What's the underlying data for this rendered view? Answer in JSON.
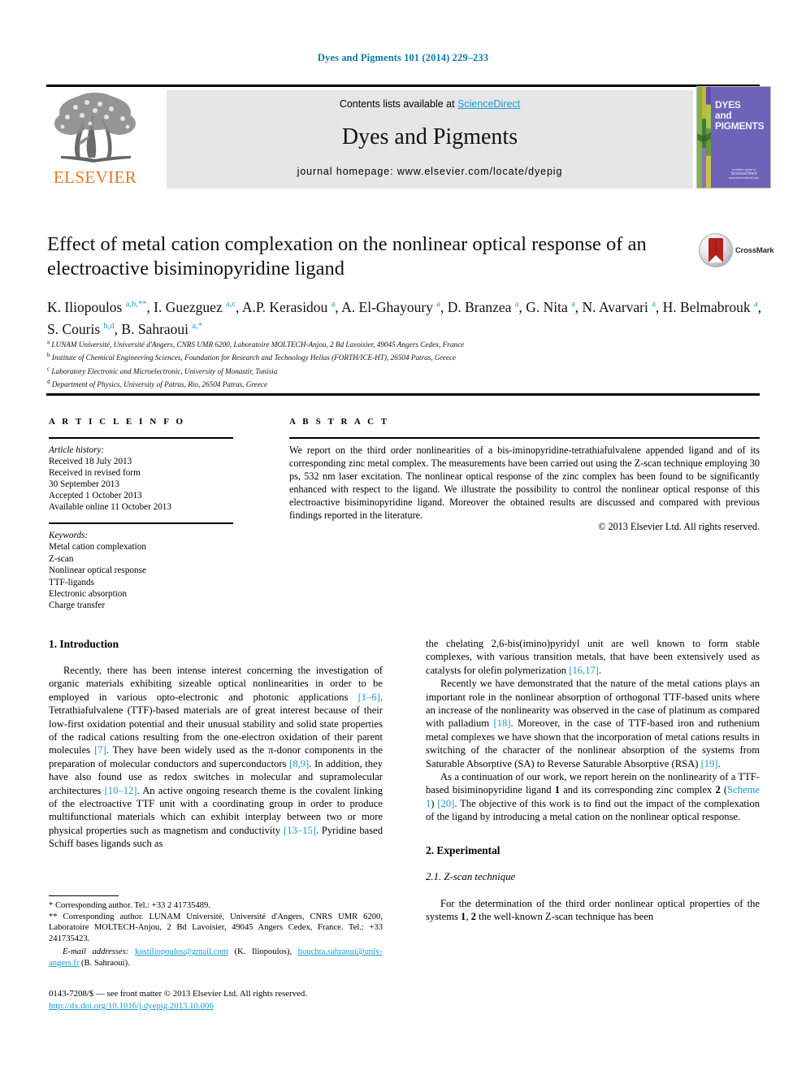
{
  "running_head": "Dyes and Pigments 101 (2014) 229–233",
  "masthead": {
    "contents_prefix": "Contents lists available at ",
    "sciencedirect": "ScienceDirect",
    "journal_name": "Dyes and Pigments",
    "homepage": "journal homepage: www.elsevier.com/locate/dyepig",
    "publisher_wordmark": "ELSEVIER",
    "cover_title": "DYES and PIGMENTS",
    "cover_footer_small": "available online at",
    "cover_footer_big": "ScienceDirect",
    "cover_footer_sub": "www.sciencedirect.com"
  },
  "article": {
    "title": "Effect of metal cation complexation on the nonlinear optical response of an electroactive bisiminopyridine ligand",
    "crossmark_label": "CrossMark",
    "authors_html": "K. Iliopoulos <sup>a,b,**</sup>, I. Guezguez <sup>a,c</sup>, A.P. Kerasidou <sup>a</sup>, A. El-Ghayoury <sup>a</sup>, D. Branzea <sup>a</sup>, G. Nita <sup>a</sup>, N. Avarvari <sup>a</sup>, H. Belmabrouk <sup>a</sup>, S. Couris <sup>b,d</sup>, B. Sahraoui <sup>a,*</sup>",
    "affiliations": [
      {
        "marker": "a",
        "text": "LUNAM Université, Université d'Angers, CNRS UMR 6200, Laboratoire MOLTECH-Anjou, 2 Bd Lavoisier, 49045 Angers Cedex, France"
      },
      {
        "marker": "b",
        "text": "Institute of Chemical Engineering Sciences, Foundation for Research and Technology Hellas (FORTH/ICE-HT), 26504 Patras, Greece"
      },
      {
        "marker": "c",
        "text": "Laboratory Electronic and Microelectronic, University of Monastir, Tunisia"
      },
      {
        "marker": "d",
        "text": "Department of Physics, University of Patras, Rio, 26504 Patras, Greece"
      }
    ]
  },
  "article_info": {
    "heading": "A R T I C L E  I N F O",
    "history_label": "Article history:",
    "history": [
      "Received 18 July 2013",
      "Received in revised form",
      "30 September 2013",
      "Accepted 1 October 2013",
      "Available online 11 October 2013"
    ],
    "keywords_label": "Keywords:",
    "keywords": [
      "Metal cation complexation",
      "Z-scan",
      "Nonlinear optical response",
      "TTF-ligands",
      "Electronic absorption",
      "Charge transfer"
    ]
  },
  "abstract": {
    "heading": "A B S T R A C T",
    "text": "We report on the third order nonlinearities of a bis-iminopyridine-tetrathiafulvalene appended ligand and of its corresponding zinc metal complex. The measurements have been carried out using the Z-scan technique employing 30 ps, 532 nm laser excitation. The nonlinear optical response of the zinc complex has been found to be significantly enhanced with respect to the ligand. We illustrate the possibility to control the nonlinear optical response of this electroactive bisiminopyridine ligand. Moreover the obtained results are discussed and compared with previous findings reported in the literature.",
    "copyright": "© 2013 Elsevier Ltd. All rights reserved."
  },
  "body": {
    "intro_heading": "1. Introduction",
    "intro_p1_a": "Recently, there has been intense interest concerning the investigation of organic materials exhibiting sizeable optical nonlinearities in order to be employed in various opto-electronic and photonic applications ",
    "intro_p1_ref1": "[1–6]",
    "intro_p1_b": ". Tetrathiafulvalene (TTF)-based materials are of great interest because of their low-first oxidation potential and their unusual stability and solid state properties of the radical cations resulting from the one-electron oxidation of their parent molecules ",
    "intro_p1_ref2": "[7]",
    "intro_p1_c": ". They have been widely used as the π-donor components in the preparation of molecular conductors and superconductors ",
    "intro_p1_ref3": "[8,9]",
    "intro_p1_d": ". In addition, they have also found use as redox switches in molecular and supramolecular architectures ",
    "intro_p1_ref4": "[10–12]",
    "intro_p1_e": ". An active ongoing research theme is the covalent linking of the electroactive TTF unit with a coordinating group in order to produce multifunctional materials which can exhibit interplay between two or more physical properties such as magnetism and conductivity ",
    "intro_p1_ref5": "[13–15]",
    "intro_p1_f": ". Pyridine based Schiff bases ligands such as",
    "right_p1_a": "the chelating 2,6-bis(imino)pyridyl unit are well known to form stable complexes, with various transition metals, that have been extensively used as catalysts for olefin polymerization ",
    "right_p1_ref": "[16,17]",
    "right_p1_b": ".",
    "right_p2_a": "Recently we have demonstrated that the nature of the metal cations plays an important role in the nonlinear absorption of orthogonal TTF-based units where an increase of the nonlinearity was observed in the case of platinum as compared with palladium ",
    "right_p2_ref1": "[18]",
    "right_p2_b": ". Moreover, in the case of TTF-based iron and ruthenium metal complexes we have shown that the incorporation of metal cations results in switching of the character of the nonlinear absorption of the systems from Saturable Absorptive (SA) to Reverse Saturable Absorptive (RSA) ",
    "right_p2_ref2": "[19]",
    "right_p2_c": ".",
    "right_p3_a": "As a continuation of our work, we report herein on the nonlinearity of a TTF-based bisiminopyridine ligand ",
    "right_p3_b1": "1",
    "right_p3_b": " and its corresponding zinc complex ",
    "right_p3_b2": "2",
    "right_p3_c": " (",
    "right_p3_scheme": "Scheme 1",
    "right_p3_d": ") ",
    "right_p3_ref": "[20]",
    "right_p3_e": ". The objective of this work is to find out the impact of the complexation of the ligand by introducing a metal cation on the nonlinear optical response.",
    "experimental_heading": "2. Experimental",
    "zscan_heading": "2.1. Z-scan technique",
    "zscan_p_a": "For the determination of the third order nonlinear optical properties of the systems ",
    "zscan_p_b1": "1",
    "zscan_p_b": ", ",
    "zscan_p_b2": "2",
    "zscan_p_c": " the well-known Z-scan technique has been"
  },
  "footnotes": {
    "fn1": "* Corresponding author. Tel.: +33 2 41735489.",
    "fn2": "** Corresponding author. LUNAM Université, Université d'Angers, CNRS UMR 6200, Laboratoire MOLTECH-Anjou, 2 Bd Lavoisier, 49045 Angers Cedex, France. Tel.: +33 241735423.",
    "email_label": "E-mail addresses:",
    "email1": "kostiliopoulos@gmail.com",
    "email1_owner": "(K. Iliopoulos)",
    "email2": "bouchta.sahraoui@univ-angers.fr",
    "email2_owner": "(B. Sahraoui)"
  },
  "front_matter": {
    "line1": "0143-7208/$ — see front matter © 2013 Elsevier Ltd. All rights reserved.",
    "doi": "http://dx.doi.org/10.1016/j.dyepig.2013.10.006"
  },
  "colors": {
    "link": "#1a9ad6",
    "running_head": "#0b7ba8",
    "elsevier_orange": "#E87722",
    "cover_purple": "#6e63b6",
    "band_gray": "#e6e6e6"
  }
}
